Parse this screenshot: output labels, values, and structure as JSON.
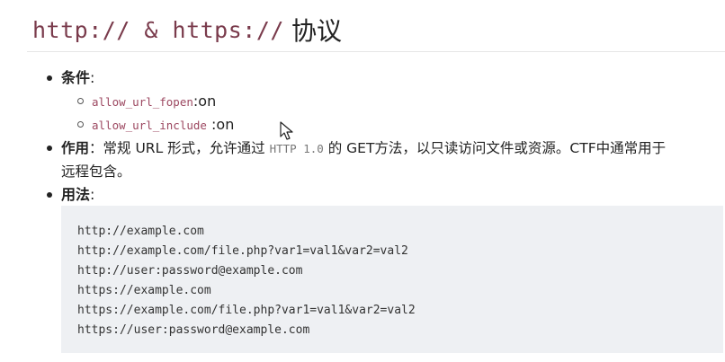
{
  "heading": {
    "code_text": "http:// & https://",
    "suffix": "协议"
  },
  "conditions": {
    "label": "条件",
    "sep": ":",
    "items": [
      {
        "code": "allow_url_fopen",
        "value": ":on"
      },
      {
        "code": "allow_url_include",
        "value": " :on"
      }
    ]
  },
  "usage_desc": {
    "label": "作用",
    "sep": "：",
    "text_before": "常规 URL 形式，允许通过 ",
    "code": "HTTP 1.0",
    "text_after": " 的 GET方法，以只读访问文件或资源。CTF中通常用于",
    "line2": "远程包含。"
  },
  "usage": {
    "label": "用法",
    "sep": ":"
  },
  "code_lines": [
    "http://example.com",
    "http://example.com/file.php?var1=val1&var2=val2",
    "http://user:password@example.com",
    "https://example.com",
    "https://example.com/file.php?var1=val1&var2=val2",
    "https://user:password@example.com"
  ]
}
